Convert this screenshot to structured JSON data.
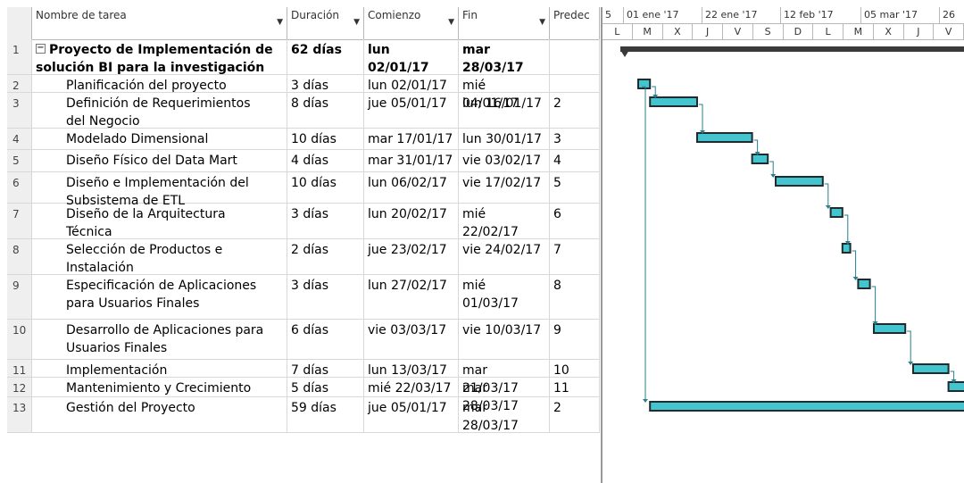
{
  "headers": {
    "id": "",
    "name": "Nombre de tarea",
    "duration": "Duración",
    "start": "Comienzo",
    "end": "Fin",
    "pred": "Predec"
  },
  "timescale": {
    "top": [
      "5",
      "01 ene '17",
      "22 ene '17",
      "12 feb '17",
      "05 mar '17",
      "26"
    ],
    "bottom": [
      "L",
      "M",
      "X",
      "J",
      "V",
      "S",
      "D",
      "L",
      "M",
      "X",
      "J",
      "V"
    ]
  },
  "tasks": [
    {
      "id": "1",
      "name": "Proyecto de Implementación de",
      "name2": "solución BI para la investigación",
      "duration": "62 días",
      "start": "lun 02/01/17",
      "end": "mar 28/03/17",
      "pred": ""
    },
    {
      "id": "2",
      "name": "Planificación del proyecto",
      "name2": "",
      "duration": "3 días",
      "start": "lun 02/01/17",
      "end": "mié 04/01/17",
      "pred": ""
    },
    {
      "id": "3",
      "name": "Definición de Requerimientos",
      "name2": "del Negocio",
      "duration": "8 días",
      "start": "jue 05/01/17",
      "end": "lun 16/01/17",
      "pred": "2"
    },
    {
      "id": "4",
      "name": "Modelado Dimensional",
      "name2": "",
      "duration": "10 días",
      "start": "mar 17/01/17",
      "end": "lun 30/01/17",
      "pred": "3"
    },
    {
      "id": "5",
      "name": "Diseño Físico del Data Mart",
      "name2": "",
      "duration": "4 días",
      "start": "mar 31/01/17",
      "end": "vie 03/02/17",
      "pred": "4"
    },
    {
      "id": "6",
      "name": "Diseño e Implementación del",
      "name2": "Subsistema de ETL",
      "duration": "10 días",
      "start": "lun 06/02/17",
      "end": "vie 17/02/17",
      "pred": "5"
    },
    {
      "id": "7",
      "name": "Diseño de la Arquitectura",
      "name2": "Técnica",
      "duration": "3 días",
      "start": "lun 20/02/17",
      "end": "mié 22/02/17",
      "pred": "6"
    },
    {
      "id": "8",
      "name": "Selección de Productos e",
      "name2": "Instalación",
      "duration": "2 días",
      "start": "jue 23/02/17",
      "end": "vie 24/02/17",
      "pred": "7"
    },
    {
      "id": "9",
      "name": "Especificación de Aplicaciones",
      "name2": "para Usuarios Finales",
      "duration": "3 días",
      "start": "lun 27/02/17",
      "end": "mié 01/03/17",
      "pred": "8"
    },
    {
      "id": "10",
      "name": "Desarrollo de Aplicaciones para",
      "name2": "Usuarios Finales",
      "duration": "6 días",
      "start": "vie 03/03/17",
      "end": "vie 10/03/17",
      "pred": "9"
    },
    {
      "id": "11",
      "name": "Implementación",
      "name2": "",
      "duration": "7 días",
      "start": "lun 13/03/17",
      "end": "mar 21/03/17",
      "pred": "10"
    },
    {
      "id": "12",
      "name": "Mantenimiento y Crecimiento",
      "name2": "",
      "duration": "5 días",
      "start": "mié 22/03/17",
      "end": "mar 28/03/17",
      "pred": "11"
    },
    {
      "id": "13",
      "name": "Gestión del Proyecto",
      "name2": "",
      "duration": "59 días",
      "start": "jue 05/01/17",
      "end": "mar 28/03/17",
      "pred": "2"
    }
  ],
  "colors": {
    "bar_fill": "#44c4cf",
    "bar_border": "#1f2b2e",
    "summary_bar": "#3a3a3a",
    "link_line": "#2a7f8a"
  }
}
